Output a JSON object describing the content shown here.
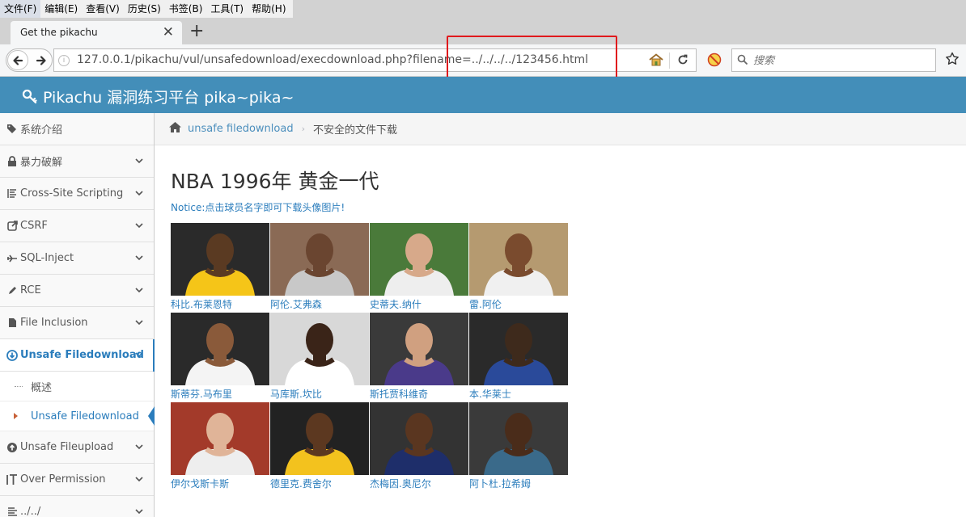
{
  "browser": {
    "menus": [
      "文件(F)",
      "编辑(E)",
      "查看(V)",
      "历史(S)",
      "书签(B)",
      "工具(T)",
      "帮助(H)"
    ],
    "tab_title": "Get the pikachu",
    "url": "127.0.0.1/pikachu/vul/unsafedownload/execdownload.php?filename=../../../../123456.html",
    "search_placeholder": "搜索"
  },
  "header": {
    "brand": "Pikachu 漏洞练习平台 pika~pika~"
  },
  "sidebar": {
    "items": [
      {
        "label": "系统介绍",
        "icon": "tags-icon"
      },
      {
        "label": "暴力破解",
        "icon": "lock-icon"
      },
      {
        "label": "Cross-Site Scripting",
        "icon": "align-icon"
      },
      {
        "label": "CSRF",
        "icon": "external-link-icon"
      },
      {
        "label": "SQL-Inject",
        "icon": "fighter-jet-icon"
      },
      {
        "label": "RCE",
        "icon": "pencil-icon"
      },
      {
        "label": "File Inclusion",
        "icon": "file-icon"
      },
      {
        "label": "Unsafe Filedownload",
        "icon": "download-icon"
      },
      {
        "label": "Unsafe Fileupload",
        "icon": "upload-icon"
      },
      {
        "label": "Over Permission",
        "icon": "text-height-icon"
      },
      {
        "label": "../../",
        "icon": "list-icon"
      }
    ],
    "subitems": [
      "概述",
      "Unsafe Filedownload"
    ]
  },
  "breadcrumb": {
    "link": "unsafe filedownload",
    "current": "不安全的文件下载"
  },
  "content": {
    "title": "NBA 1996年 黄金一代",
    "notice": "Notice:点击球员名字即可下载头像图片!",
    "players": [
      {
        "name": "科比.布莱恩特",
        "jersey": "#f5c518",
        "bg": "#2a2a2a",
        "skin": "#5a3a22"
      },
      {
        "name": "阿伦.艾弗森",
        "jersey": "#c8c8c8",
        "bg": "#8a6a55",
        "skin": "#6a4530"
      },
      {
        "name": "史蒂夫.纳什",
        "jersey": "#eeeeee",
        "bg": "#4a7a3a",
        "skin": "#d7a98a"
      },
      {
        "name": "雷.阿伦",
        "jersey": "#f0f0f0",
        "bg": "#b59a70",
        "skin": "#7a4b2e"
      },
      {
        "name": "斯蒂芬.马布里",
        "jersey": "#f4f4f4",
        "bg": "#2a2a2a",
        "skin": "#8a5a3a"
      },
      {
        "name": "马库斯.坎比",
        "jersey": "#ffffff",
        "bg": "#d8d8d8",
        "skin": "#3a2418"
      },
      {
        "name": "斯托贾科维奇",
        "jersey": "#4a3a8a",
        "bg": "#3a3a3a",
        "skin": "#d0a080"
      },
      {
        "name": "本.华莱士",
        "jersey": "#2a4a9a",
        "bg": "#2a2a2a",
        "skin": "#3e2a1c"
      },
      {
        "name": "伊尔戈斯卡斯",
        "jersey": "#eeeeee",
        "bg": "#a33a2a",
        "skin": "#e0b498"
      },
      {
        "name": "德里克.费舍尔",
        "jersey": "#f3c21e",
        "bg": "#222222",
        "skin": "#5c3820"
      },
      {
        "name": "杰梅因.奥尼尔",
        "jersey": "#1e2e6a",
        "bg": "#333333",
        "skin": "#5a3620"
      },
      {
        "name": "阿卜杜.拉希姆",
        "jersey": "#3a6a8a",
        "bg": "#3a3a3a",
        "skin": "#4a2c1a"
      }
    ]
  },
  "colors": {
    "header": "#438eb9",
    "link": "#2b7dbc",
    "highlight_box": "#e0191d"
  }
}
